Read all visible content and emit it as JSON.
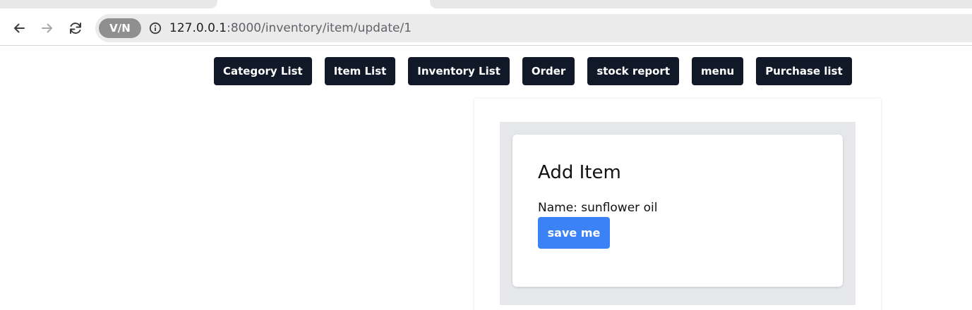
{
  "browser": {
    "url_host": "127.0.0.1",
    "url_rest": ":8000/inventory/item/update/1",
    "vpn_label": "V∕N",
    "icons": {
      "back": "arrow-left-icon",
      "forward": "arrow-right-icon",
      "reload": "reload-icon",
      "info": "info-icon"
    }
  },
  "nav": {
    "items": [
      {
        "label": "Category List"
      },
      {
        "label": "Item List"
      },
      {
        "label": "Inventory List"
      },
      {
        "label": "Order"
      },
      {
        "label": "stock report"
      },
      {
        "label": "menu"
      },
      {
        "label": "Purchase list"
      }
    ]
  },
  "form": {
    "title": "Add Item",
    "name_label": "Name:",
    "name_value": "sunflower oil",
    "save_label": "save me"
  },
  "colors": {
    "nav_button_bg": "#111827",
    "save_button_bg": "#3b82f6",
    "panel_bg": "#e5e7eb"
  }
}
